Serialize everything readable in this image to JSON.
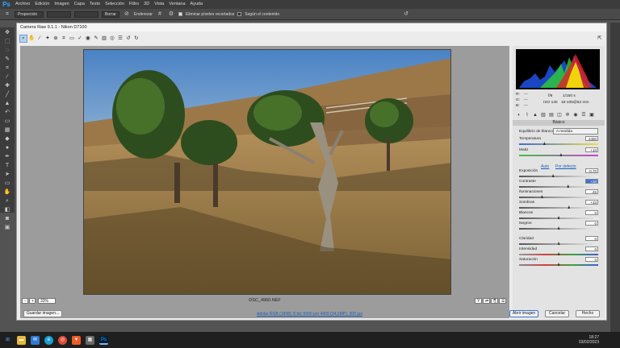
{
  "app": {
    "logo": "Ps"
  },
  "menubar": [
    "Archivo",
    "Edición",
    "Imagen",
    "Capa",
    "Texto",
    "Selección",
    "Filtro",
    "3D",
    "Vista",
    "Ventana",
    "Ayuda"
  ],
  "options": {
    "mode": "Proporción",
    "clear": "Borrar",
    "straighten": "Enderezar",
    "delete_cropped": "Eliminar píxeles recortados",
    "content_aware": "Según el contenido"
  },
  "camera_raw": {
    "title": "Camera Raw 9.1.1 - Nikon D7100",
    "filename": "DSC_4960.NEF",
    "zoom": "33%",
    "workflow_link": "Adobe RGB (1998); 8 bit; 6000 por 4000 (24,0MP); 300 ppi",
    "buttons": {
      "save": "Guardar imagen...",
      "open": "Abrir imagen",
      "cancel": "Cancelar",
      "done": "Hecho"
    }
  },
  "camera_info": {
    "r": "R:",
    "g": "G:",
    "b": "B:",
    "dash": "---",
    "aperture": "f/8",
    "shutter": "1/160 s",
    "iso": "ISO 140",
    "lens": "18-105@52 mm"
  },
  "panel": {
    "title": "Básico",
    "wb_label": "Equilibrio de blancos:",
    "wb_value": "A medida",
    "auto": "Auto",
    "default": "Por defecto",
    "sliders": [
      {
        "name": "Temperatura",
        "value": "4450",
        "pos": 0.32
      },
      {
        "name": "Matiz",
        "value": "+10",
        "pos": 0.53
      },
      {
        "name": "Exposición",
        "value": "-0,70",
        "pos": 0.43
      },
      {
        "name": "Contraste",
        "value": "+34",
        "pos": 0.62
      },
      {
        "name": "Iluminaciones",
        "value": "-46",
        "pos": 0.29
      },
      {
        "name": "Sombras",
        "value": "+33",
        "pos": 0.63
      },
      {
        "name": "Blancos",
        "value": "0",
        "pos": 0.5
      },
      {
        "name": "Negros",
        "value": "0",
        "pos": 0.5
      },
      {
        "name": "Claridad",
        "value": "0",
        "pos": 0.5
      },
      {
        "name": "Intensidad",
        "value": "0",
        "pos": 0.5
      },
      {
        "name": "Saturación",
        "value": "0",
        "pos": 0.5
      }
    ]
  },
  "clock": {
    "time": "18:27",
    "date": "03/02/2023"
  }
}
